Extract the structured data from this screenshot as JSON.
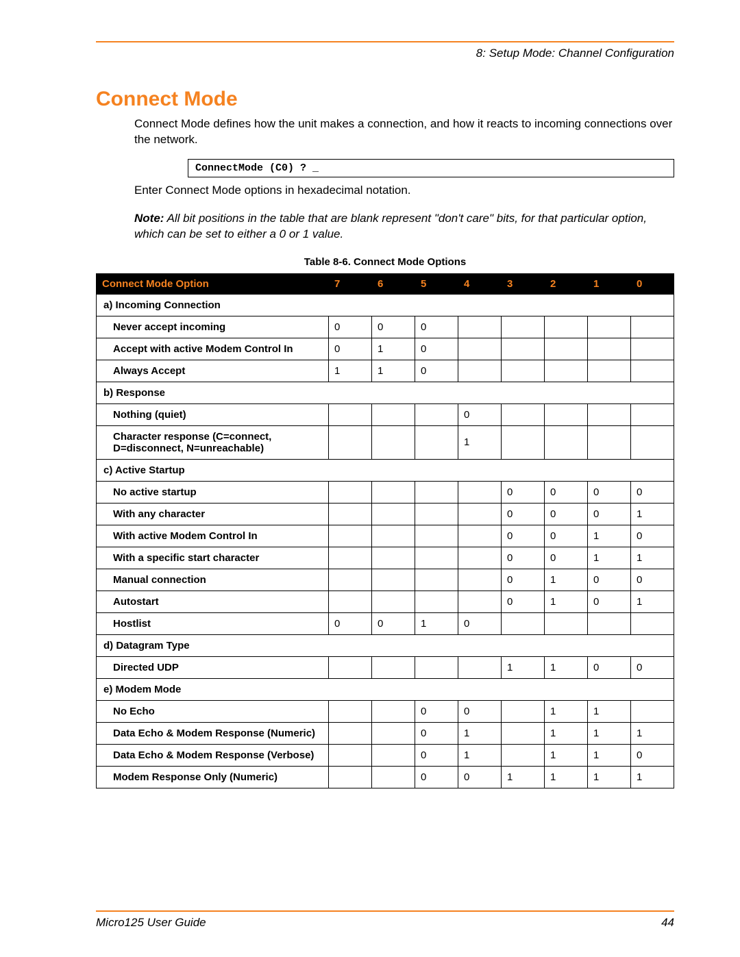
{
  "header": {
    "section": "8: Setup Mode: Channel Configuration"
  },
  "title": "Connect Mode",
  "intro": "Connect Mode defines how the unit makes a connection, and how it reacts to incoming connections over the network.",
  "code": "ConnectMode (C0) ? _",
  "enter": "Enter Connect Mode options in hexadecimal notation.",
  "note_label": "Note:",
  "note_text": "All bit positions in the table that are blank represent \"don't care\" bits, for that particular option, which can be set to either a 0 or 1 value.",
  "table_caption": "Table 8-6. Connect Mode Options",
  "columns": {
    "option": "Connect Mode Option",
    "bits": [
      "7",
      "6",
      "5",
      "4",
      "3",
      "2",
      "1",
      "0"
    ]
  },
  "rows": [
    {
      "type": "section",
      "label": "a) Incoming Connection"
    },
    {
      "type": "opt",
      "label": "Never accept incoming",
      "bits": [
        "0",
        "0",
        "0",
        "",
        "",
        "",
        "",
        ""
      ]
    },
    {
      "type": "opt",
      "label": "Accept with active Modem Control In",
      "bits": [
        "0",
        "1",
        "0",
        "",
        "",
        "",
        "",
        ""
      ]
    },
    {
      "type": "opt",
      "label": "Always Accept",
      "bits": [
        "1",
        "1",
        "0",
        "",
        "",
        "",
        "",
        ""
      ]
    },
    {
      "type": "section",
      "label": "b) Response"
    },
    {
      "type": "opt",
      "label": "Nothing (quiet)",
      "bits": [
        "",
        "",
        "",
        "0",
        "",
        "",
        "",
        ""
      ]
    },
    {
      "type": "opt",
      "label": "Character response (C=connect, D=disconnect, N=unreachable)",
      "bits": [
        "",
        "",
        "",
        "1",
        "",
        "",
        "",
        ""
      ]
    },
    {
      "type": "section",
      "label": "c) Active Startup"
    },
    {
      "type": "opt",
      "label": "No active startup",
      "bits": [
        "",
        "",
        "",
        "",
        "0",
        "0",
        "0",
        "0"
      ]
    },
    {
      "type": "opt",
      "label": "With any character",
      "bits": [
        "",
        "",
        "",
        "",
        "0",
        "0",
        "0",
        "1"
      ]
    },
    {
      "type": "opt",
      "label": "With active Modem Control In",
      "bits": [
        "",
        "",
        "",
        "",
        "0",
        "0",
        "1",
        "0"
      ]
    },
    {
      "type": "opt",
      "label": "With a specific start character",
      "bits": [
        "",
        "",
        "",
        "",
        "0",
        "0",
        "1",
        "1"
      ]
    },
    {
      "type": "opt",
      "label": "Manual connection",
      "bits": [
        "",
        "",
        "",
        "",
        "0",
        "1",
        "0",
        "0"
      ]
    },
    {
      "type": "opt",
      "label": "Autostart",
      "bits": [
        "",
        "",
        "",
        "",
        "0",
        "1",
        "0",
        "1"
      ]
    },
    {
      "type": "opt",
      "label": "Hostlist",
      "bits": [
        "0",
        "0",
        "1",
        "0",
        "",
        "",
        "",
        ""
      ]
    },
    {
      "type": "section",
      "label": "d) Datagram Type"
    },
    {
      "type": "opt",
      "label": "Directed UDP",
      "bits": [
        "",
        "",
        "",
        "",
        "1",
        "1",
        "0",
        "0"
      ]
    },
    {
      "type": "section",
      "label": "e) Modem Mode"
    },
    {
      "type": "opt",
      "label": "No Echo",
      "bits": [
        "",
        "",
        "0",
        "0",
        "",
        "1",
        "1",
        ""
      ]
    },
    {
      "type": "opt",
      "label": "Data Echo & Modem Response (Numeric)",
      "bits": [
        "",
        "",
        "0",
        "1",
        "",
        "1",
        "1",
        "1"
      ]
    },
    {
      "type": "opt",
      "label": "Data Echo & Modem Response (Verbose)",
      "bits": [
        "",
        "",
        "0",
        "1",
        "",
        "1",
        "1",
        "0"
      ]
    },
    {
      "type": "opt",
      "label": "Modem Response Only (Numeric)",
      "bits": [
        "",
        "",
        "0",
        "0",
        "1",
        "1",
        "1",
        "1"
      ]
    }
  ],
  "footer": {
    "guide": "Micro125 User Guide",
    "page": "44"
  }
}
